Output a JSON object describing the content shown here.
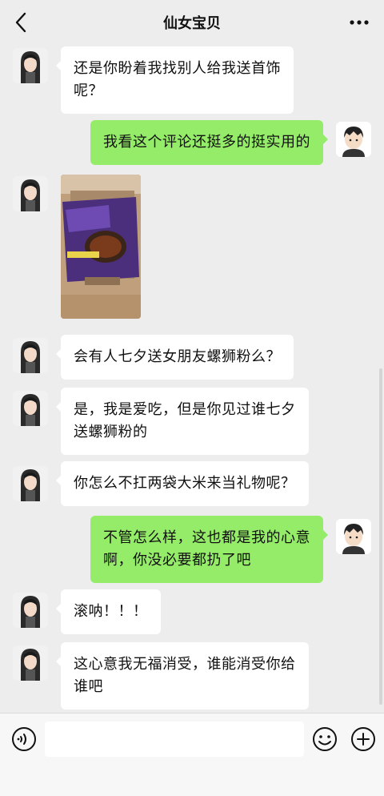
{
  "header": {
    "title": "仙女宝贝",
    "back_icon": "chevron-left-icon",
    "more_icon": "more-dots-icon"
  },
  "messages": [
    {
      "side": "left",
      "text_lines": [
        "还是你盼着我找别人给我送首饰",
        "呢？"
      ]
    },
    {
      "side": "right",
      "text_lines": [
        "我看这个评论还挺多的挺实用的"
      ]
    },
    {
      "side": "left",
      "type": "image",
      "image_desc_icon": "snail-noodle-package-photo"
    },
    {
      "side": "left",
      "text_lines": [
        "会有人七夕送女朋友螺狮粉么？"
      ]
    },
    {
      "side": "left",
      "text_lines": [
        "是，我是爱吃，但是你见过谁七夕",
        "送螺狮粉的"
      ]
    },
    {
      "side": "left",
      "text_lines": [
        "你怎么不扛两袋大米来当礼物呢？"
      ]
    },
    {
      "side": "right",
      "text_lines": [
        "不管怎么样，这也都是我的心意",
        "啊，你没必要都扔了吧"
      ]
    },
    {
      "side": "left",
      "text_lines": [
        "滚呐！！！"
      ]
    },
    {
      "side": "left",
      "text_lines": [
        "这心意我无福消受，谁能消受你给",
        "谁吧"
      ]
    }
  ],
  "input_bar": {
    "voice_icon": "voice-icon",
    "emoji_icon": "emoji-icon",
    "plus_icon": "plus-circle-icon",
    "input_value": ""
  },
  "colors": {
    "background": "#ededed",
    "self_bubble": "#95ec69",
    "other_bubble": "#ffffff"
  }
}
